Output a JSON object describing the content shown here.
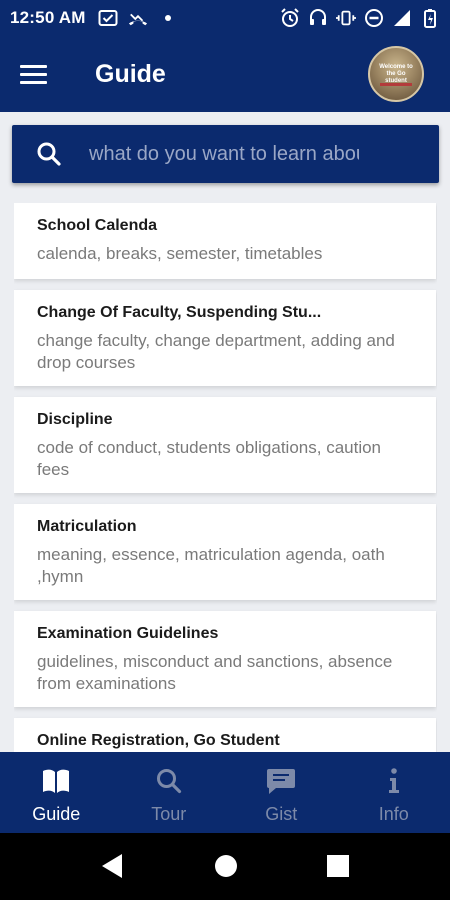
{
  "status_bar": {
    "time": "12:50 AM",
    "left_icons": [
      "checkbox-icon",
      "missed-call-icon",
      "dot-icon"
    ],
    "right_icons": [
      "alarm-icon",
      "headset-icon",
      "vibrate-icon",
      "do-not-disturb-icon",
      "signal-icon",
      "battery-icon"
    ]
  },
  "app_bar": {
    "title": "Guide",
    "avatar_text": "Welcome to the Go student"
  },
  "search": {
    "placeholder": "what do you want to learn about?"
  },
  "guide_items": [
    {
      "title": "School Calenda",
      "subtitle": "calenda, breaks, semester, timetables"
    },
    {
      "title": "Change Of Faculty, Suspending Stu...",
      "subtitle": "change faculty, change department, adding and drop courses"
    },
    {
      "title": "Discipline",
      "subtitle": "code of conduct, students obligations, caution fees"
    },
    {
      "title": "Matriculation",
      "subtitle": "meaning, essence, matriculation agenda, oath ,hymn"
    },
    {
      "title": "Examination Guidelines",
      "subtitle": "guidelines, misconduct and sanctions, absence from examinations"
    },
    {
      "title": "Online Registration, Go Student",
      "subtitle": ""
    }
  ],
  "bottom_nav": {
    "items": [
      {
        "label": "Guide",
        "icon": "book-icon",
        "active": true
      },
      {
        "label": "Tour",
        "icon": "search-icon",
        "active": false
      },
      {
        "label": "Gist",
        "icon": "chat-icon",
        "active": false
      },
      {
        "label": "Info",
        "icon": "info-icon",
        "active": false
      }
    ]
  },
  "colors": {
    "primary": "#0b2a6e",
    "background": "#eceef2",
    "inactive_nav": "#7d8aa9"
  }
}
